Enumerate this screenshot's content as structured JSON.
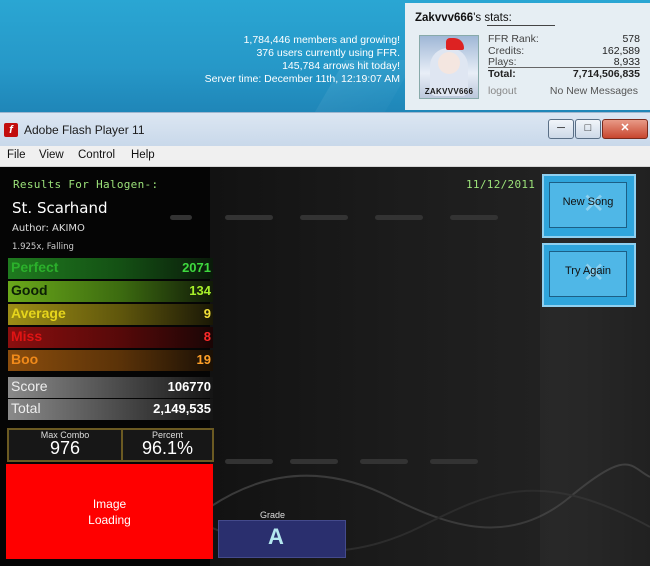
{
  "banner": {
    "members": "1,784,446 members and growing!",
    "users": "376 users currently using FFR.",
    "arrows": "145,784 arrows hit today!",
    "server_time": "Server time: December 11th, 12:19:07 AM"
  },
  "stats_panel": {
    "username": "Zakvvv666",
    "title_suffix": "'s stats:",
    "avatar_name": "ZAKVVV666",
    "rows": [
      {
        "label": "FFR Rank:",
        "value": "578"
      },
      {
        "label": "Credits:",
        "value": "162,589"
      },
      {
        "label": "Plays:",
        "value": "8,933"
      },
      {
        "label": "Total:",
        "value": "7,714,506,835"
      }
    ],
    "logout": "logout",
    "messages": "No New Messages"
  },
  "window": {
    "title": "Adobe Flash Player 11",
    "icon": "f",
    "min": "─",
    "max": "□",
    "close": "✕"
  },
  "menu": [
    "File",
    "View",
    "Control",
    "Help"
  ],
  "results": {
    "heading": "Results For Halogen-:",
    "date": "11/12/2011",
    "song": "St. Scarhand",
    "author": "Author: AKIMO",
    "mods": "1.925x, Falling",
    "judgements": [
      {
        "label": "Perfect",
        "value": "2071",
        "color": "#2bb02b"
      },
      {
        "label": "Good",
        "value": "134",
        "color": "#8fd820"
      },
      {
        "label": "Average",
        "value": "9",
        "color": "#e6d51c"
      },
      {
        "label": "Miss",
        "value": "8",
        "color": "#e01414"
      },
      {
        "label": "Boo",
        "value": "19",
        "color": "#f08a1a"
      }
    ],
    "score_label": "Score",
    "score": "106770",
    "total_label": "Total",
    "total": "2,149,535",
    "max_combo_label": "Max Combo",
    "max_combo": "976",
    "percent_label": "Percent",
    "percent": "96.1%",
    "image_line1": "Image",
    "image_line2": "Loading",
    "grade_label": "Grade",
    "grade": "A"
  },
  "buttons": {
    "new_song": "New Song",
    "try_again": "Try Again"
  }
}
